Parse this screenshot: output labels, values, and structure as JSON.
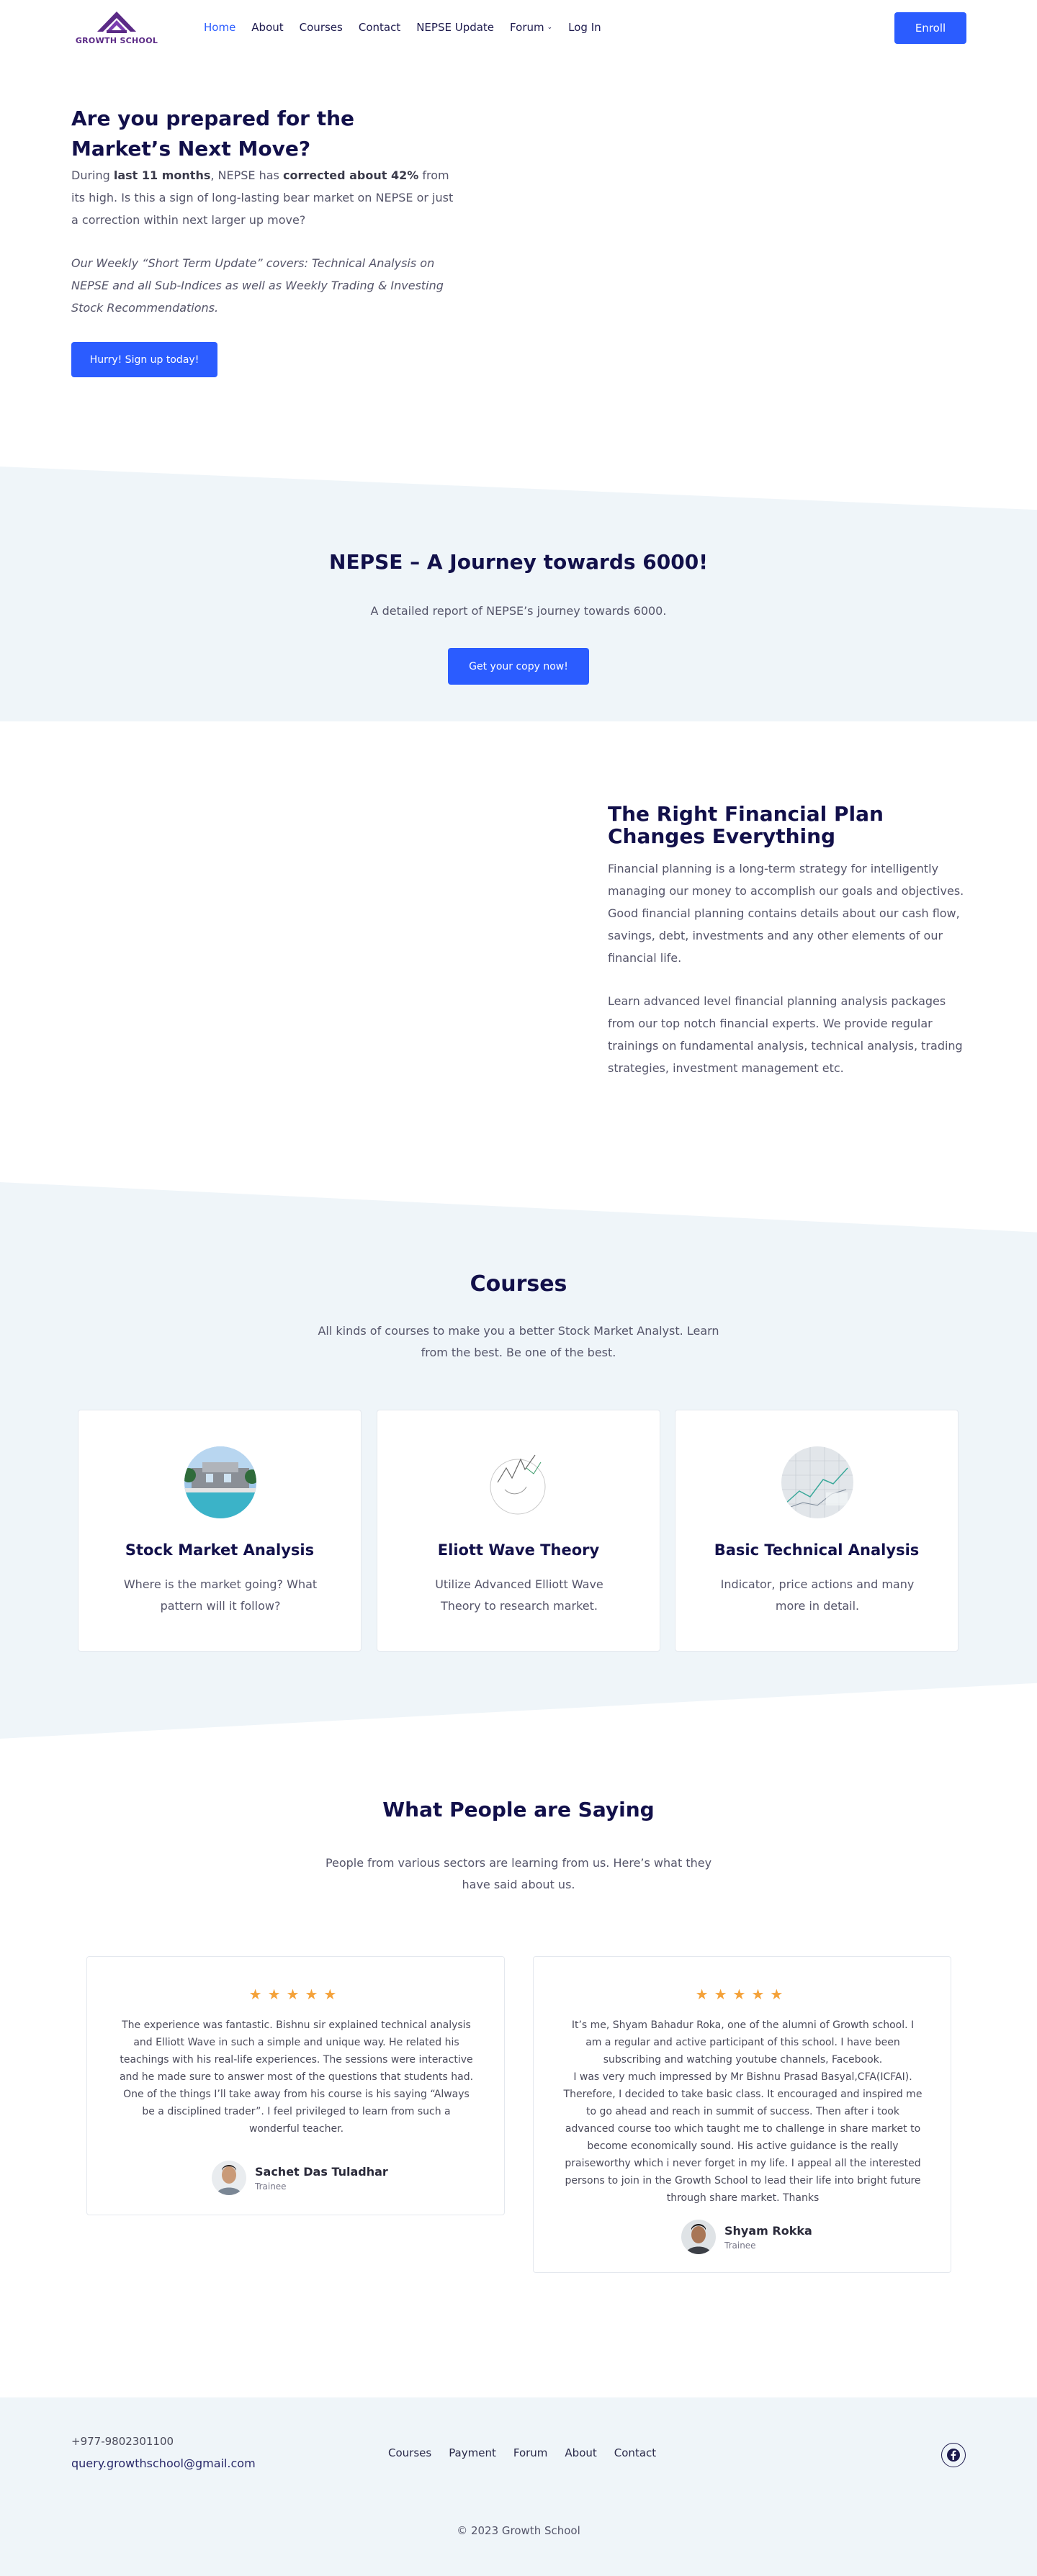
{
  "header": {
    "logo_text": "GROWTH SCHOOL",
    "nav": [
      {
        "label": "Home",
        "active": true
      },
      {
        "label": "About"
      },
      {
        "label": "Courses"
      },
      {
        "label": "Contact"
      },
      {
        "label": "NEPSE Update"
      },
      {
        "label": "Forum",
        "has_dropdown": true
      },
      {
        "label": "Log In"
      }
    ],
    "enroll_label": "Enroll"
  },
  "hero": {
    "title": "Are you prepared for the Market’s Next Move?",
    "p1_a": "During ",
    "p1_b": "last 11 months",
    "p1_c": ", NEPSE has ",
    "p1_d": "corrected about 42%",
    "p1_e": " from its high. Is this a sign of long-lasting bear market on NEPSE or just a correction within next larger up move?",
    "p2": "Our Weekly “Short Term Update” covers: Technical Analysis on NEPSE and all Sub-Indices as well as Weekly Trading & Investing Stock Recommendations.",
    "cta": "Hurry! Sign up today!"
  },
  "journey": {
    "title": "NEPSE – A Journey towards 6000!",
    "subtitle": "A detailed report of NEPSE’s journey towards 6000.",
    "cta": "Get your copy now!"
  },
  "plan": {
    "title": "The Right Financial Plan Changes Everything",
    "p1": "Financial planning is a long-term strategy for intelligently managing our money to accomplish our goals and objectives. Good financial planning contains details about our cash flow, savings, debt, investments and any other elements of our financial life.",
    "p2": "Learn advanced level financial planning analysis packages from our top notch financial experts. We provide regular trainings on fundamental analysis, technical analysis, trading strategies, investment management etc."
  },
  "courses": {
    "title": "Courses",
    "subtitle": "All kinds of courses to make you a better Stock Market Analyst. Learn from the best. Be one of the best.",
    "items": [
      {
        "title": "Stock Market Analysis",
        "desc": "Where is the market going? What pattern will it follow?"
      },
      {
        "title": "Eliott Wave Theory",
        "desc": "Utilize Advanced Elliott Wave Theory to research market."
      },
      {
        "title": "Basic Technical Analysis",
        "desc": "Indicator, price actions and many more in detail."
      }
    ]
  },
  "testimonials": {
    "title": "What People are Saying",
    "subtitle": "People from various sectors are learning from us. Here’s what they have said about us.",
    "items": [
      {
        "stars": "★★★★★",
        "quote": "The experience was fantastic. Bishnu sir explained technical analysis and Elliott Wave in such a simple and unique way. He related his teachings with his real-life experiences. The sessions were interactive and he made sure to answer most of the questions that students had. One of the things I’ll take away from his course is his saying “Always be a disciplined trader”. I feel privileged to learn from such a wonderful teacher.",
        "name": "Sachet Das Tuladhar",
        "role": "Trainee"
      },
      {
        "stars": "★★★★★",
        "quote": "It’s me, Shyam Bahadur Roka, one of the alumni of Growth school. I am a regular and active participant of this school. I have been subscribing and watching youtube channels, Facebook.\nI was very much impressed by Mr Bishnu Prasad Basyal,CFA(ICFAI). Therefore, I decided to take basic class. It encouraged and inspired me to go ahead and reach in summit of success. Then after i took advanced course too which taught me to challenge in share market to become economically sound. His active guidance is the really praiseworthy which i never forget in my life. I appeal all the interested persons to join in the Growth School to lead their life into bright future through share market. Thanks",
        "name": "Shyam Rokka",
        "role": "Trainee"
      }
    ]
  },
  "footer": {
    "phone": "+977-9802301100",
    "email": "query.growthschool@gmail.com",
    "nav": [
      "Courses",
      "Payment",
      "Forum",
      "About",
      "Contact"
    ],
    "copyright": "© 2023 Growth School"
  },
  "colors": {
    "accent": "#2b5cff",
    "heading": "#12104a",
    "band": "#eff5f9",
    "star": "#f4a23a",
    "logo": "#5b2a86"
  }
}
